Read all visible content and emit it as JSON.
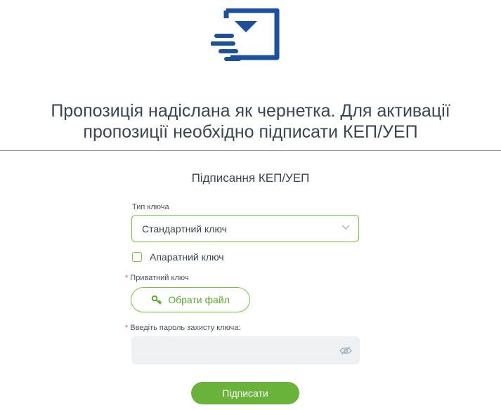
{
  "message": {
    "line1": "Пропозиція надіслана як чернетка. Для активації",
    "line2": "пропозиції необхідно підписати КЕП/УЕП"
  },
  "form": {
    "title": "Підписання КЕП/УЕП",
    "key_type": {
      "label": "Тип ключа",
      "value": "Стандартний ключ"
    },
    "hardware_key": {
      "label": "Апаратний ключ",
      "checked": false
    },
    "private_key": {
      "required_mark": "*",
      "label": "Приватний ключ",
      "button_label": "Обрати файл"
    },
    "password": {
      "required_mark": "*",
      "label": "Введіть пароль захисту ключа:",
      "value": ""
    },
    "submit_label": "Підписати"
  },
  "icons": {
    "header": "sent-envelope-icon",
    "select": "chevron-down-icon",
    "file": "key-icon",
    "password": "eye-off-icon"
  },
  "colors": {
    "accent": "#6ab33b",
    "envelope": "#1c4f9c",
    "text": "#3a4552",
    "required": "#d9534f"
  }
}
